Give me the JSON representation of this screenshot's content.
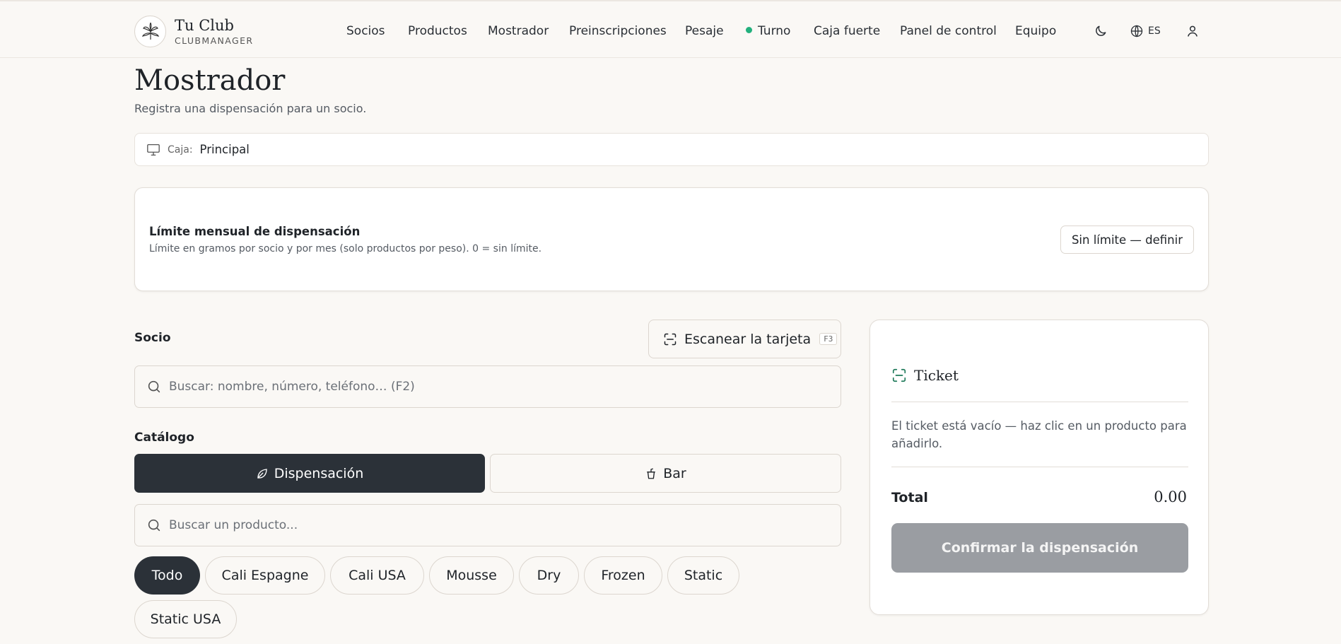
{
  "brand": {
    "title": "Tu Club",
    "subtitle": "CLUBMANAGER"
  },
  "nav": {
    "items": [
      "Socios",
      "Productos",
      "Mostrador",
      "Preinscripciones",
      "Pesaje",
      "Turno",
      "Caja fuerte",
      "Panel de control",
      "Equipo"
    ],
    "turno_status_color": "#22b07d"
  },
  "header_actions": {
    "language": "ES"
  },
  "page": {
    "title": "Mostrador",
    "subtitle": "Registra una dispensación para un socio."
  },
  "caja": {
    "label": "Caja:",
    "value": "Principal"
  },
  "limit": {
    "title": "Límite mensual de dispensación",
    "description": "Límite en gramos por socio y por mes (solo productos por peso). 0 = sin límite.",
    "button": "Sin límite — definir"
  },
  "socio": {
    "label": "Socio",
    "scan_button": "Escanear la tarjeta",
    "scan_shortcut": "F3",
    "search_placeholder": "Buscar: nombre, número, teléfono… (F2)"
  },
  "catalog": {
    "label": "Catálogo",
    "tabs": [
      "Dispensación",
      "Bar"
    ],
    "active_tab": "Dispensación",
    "search_placeholder": "Buscar un producto...",
    "categories": [
      "Todo",
      "Cali Espagne",
      "Cali USA",
      "Mousse",
      "Dry",
      "Frozen",
      "Static",
      "Static USA"
    ],
    "active_category": "Todo"
  },
  "ticket": {
    "title": "Ticket",
    "empty_message": "El ticket está vacío — haz clic en un producto para añadirlo.",
    "total_label": "Total",
    "total_value": "0.00",
    "confirm_button": "Confirmar la dispensación"
  },
  "colors": {
    "accent_dark": "#2b3138",
    "ticket_icon": "#1f7a5a",
    "background": "#faf8f5"
  }
}
